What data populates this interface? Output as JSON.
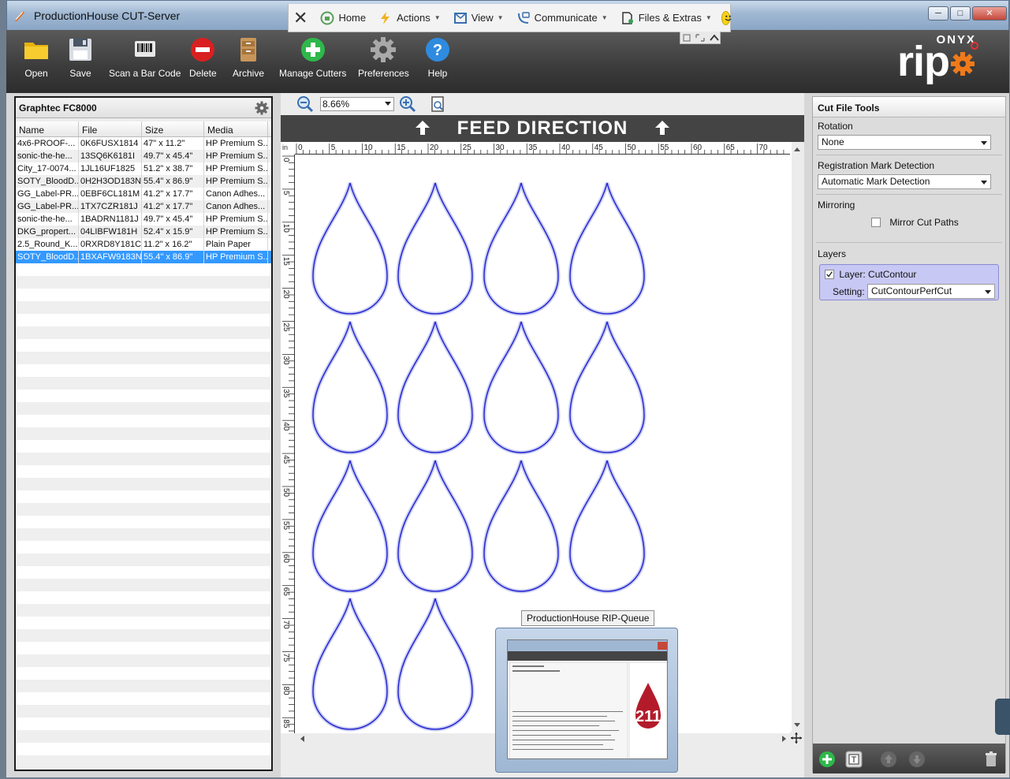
{
  "window": {
    "title": "ProductionHouse CUT-Server",
    "close_glyph": "✕",
    "minimize_glyph": "─",
    "maximize_glyph": "□"
  },
  "remote_toolbar": {
    "items": [
      {
        "label": "Home",
        "icon": "home-icon"
      },
      {
        "label": "Actions",
        "icon": "lightning-icon"
      },
      {
        "label": "View",
        "icon": "view-icon"
      },
      {
        "label": "Communicate",
        "icon": "chat-icon"
      },
      {
        "label": "Files & Extras",
        "icon": "files-icon"
      }
    ]
  },
  "toolbar": {
    "buttons": [
      {
        "label": "Open",
        "icon": "folder-icon"
      },
      {
        "label": "Save",
        "icon": "floppy-icon"
      },
      {
        "label": "Scan a Bar Code",
        "icon": "barcode-icon"
      },
      {
        "label": "Delete",
        "icon": "delete-icon"
      },
      {
        "label": "Archive",
        "icon": "archive-icon"
      },
      {
        "label": "Manage Cutters",
        "icon": "plus-icon"
      },
      {
        "label": "Preferences",
        "icon": "gear-icon"
      },
      {
        "label": "Help",
        "icon": "help-icon"
      }
    ],
    "brand": {
      "top": "ONYX",
      "main": "rip"
    }
  },
  "left_panel": {
    "title": "Graphtec FC8000",
    "columns": [
      "Name",
      "File",
      "Size",
      "Media"
    ],
    "rows": [
      [
        "4x6-PROOF-...",
        "0K6FUSX1814",
        "47\" x 11.2\"",
        "HP Premium S..."
      ],
      [
        "sonic-the-he...",
        "13SQ6K6181I",
        "49.7\" x 45.4\"",
        "HP Premium S..."
      ],
      [
        "City_17-0074...",
        "1JL16UF1825",
        "51.2\" x 38.7\"",
        "HP Premium S..."
      ],
      [
        "SOTY_BloodD...",
        "0H2H3OD183N",
        "55.4\" x 86.9\"",
        "HP Premium S..."
      ],
      [
        "GG_Label-PR...",
        "0EBF6CL181M",
        "41.2\" x 17.7\"",
        "Canon Adhes..."
      ],
      [
        "GG_Label-PR...",
        "1TX7CZR181J",
        "41.2\" x 17.7\"",
        "Canon Adhes..."
      ],
      [
        "sonic-the-he...",
        "1BADRN1181J",
        "49.7\" x 45.4\"",
        "HP Premium S..."
      ],
      [
        "DKG_propert...",
        "04LIBFW181H",
        "52.4\" x 15.9\"",
        "HP Premium S..."
      ],
      [
        "2.5_Round_K...",
        "0RXRD8Y181C",
        "11.2\" x 16.2\"",
        "Plain Paper"
      ],
      [
        "SOTY_BloodD...",
        "1BXAFW9183N",
        "55.4\" x 86.9\"",
        "HP Premium S..."
      ]
    ],
    "selected_row": 9
  },
  "canvas": {
    "zoom_value": "8.66%",
    "feed_label": "FEED DIRECTION",
    "ruler_unit": "in",
    "h_ticks": [
      "0",
      "5",
      "10",
      "15",
      "20",
      "25",
      "30",
      "35",
      "40",
      "45",
      "50",
      "55",
      "60",
      "65",
      "70"
    ],
    "v_ticks": [
      "0",
      "5",
      "10",
      "15",
      "20",
      "25",
      "30",
      "35",
      "40",
      "45",
      "50",
      "55",
      "60",
      "65",
      "70",
      "75",
      "80",
      "85"
    ],
    "drop_rows": [
      4,
      4,
      4,
      2
    ]
  },
  "right_panel": {
    "title": "Cut File Tools",
    "rotation_label": "Rotation",
    "rotation_value": "None",
    "registration_label": "Registration Mark Detection",
    "registration_value": "Automatic Mark Detection",
    "mirroring_label": "Mirroring",
    "mirror_checkbox_label": "Mirror Cut Paths",
    "mirror_checked": false,
    "layers_label": "Layers",
    "layer_label": "Layer: CutContour",
    "layer_checked": true,
    "setting_label": "Setting:",
    "setting_value": "CutContourPerfCut"
  },
  "rip_queue": {
    "label": "ProductionHouse RIP-Queue",
    "badge_number": "211"
  },
  "colors": {
    "selection": "#3399ff",
    "cut_path": "#2020d0",
    "toolbar_dark": "#3b3b3b",
    "brand_orange": "#f07a1a"
  }
}
